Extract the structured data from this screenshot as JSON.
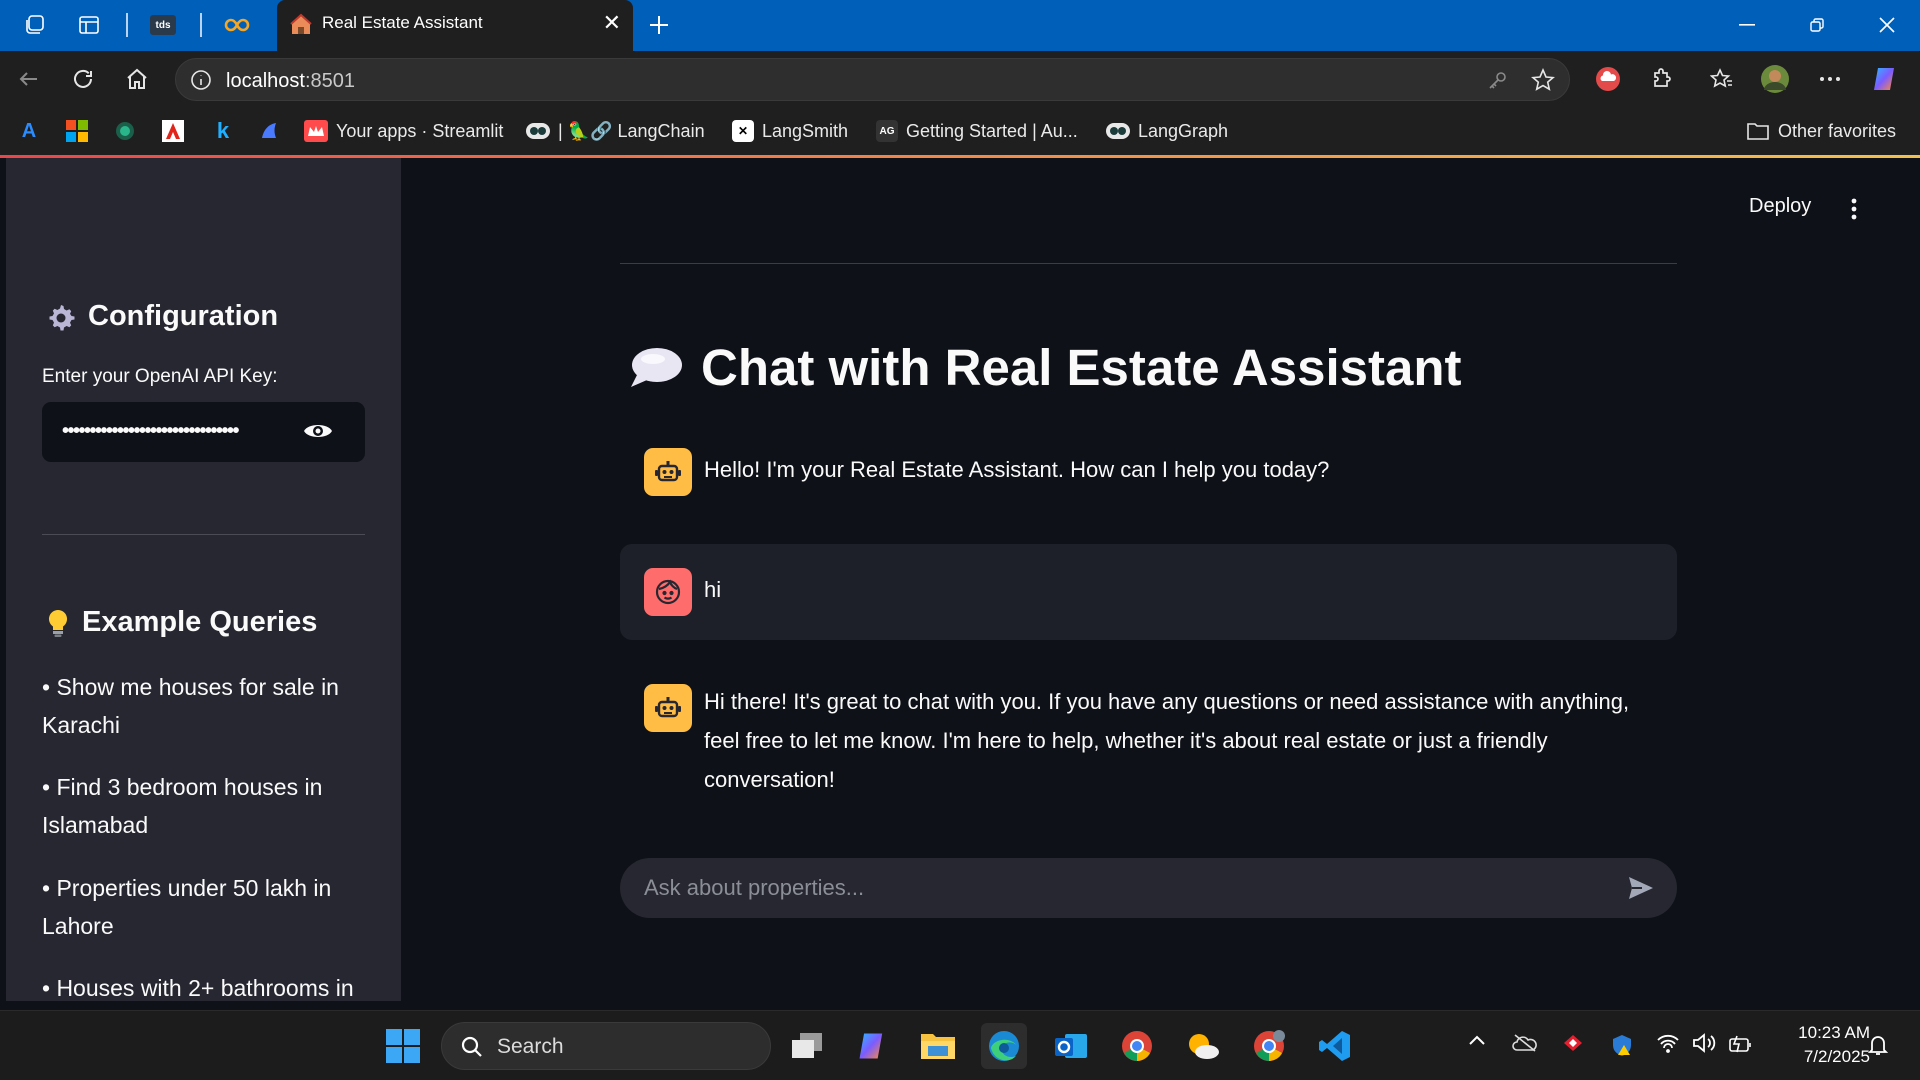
{
  "browser": {
    "tabs": [
      {
        "label": "tds"
      },
      {
        "label": "Real Estate Assistant",
        "active": true
      }
    ],
    "address": {
      "host": "localhost",
      "port": ":8501"
    },
    "bookmarks": [
      {
        "label": "Your apps · Streamlit"
      },
      {
        "label": "| 🦜🔗 LangChain"
      },
      {
        "label": "LangSmith"
      },
      {
        "label": "Getting Started | Au..."
      },
      {
        "label": "LangGraph"
      }
    ],
    "other_favorites": "Other favorites"
  },
  "sidebar": {
    "config_title": "Configuration",
    "api_key_label": "Enter your OpenAI API Key:",
    "api_key_masked": "••••••••••••••••••••••••••••••••",
    "examples_title": "Example Queries",
    "examples": [
      "• Show me houses for sale in Karachi",
      "• Find 3 bedroom houses in Islamabad",
      "• Properties under 50 lakh in Lahore",
      "• Houses with 2+ bathrooms in"
    ]
  },
  "header": {
    "deploy_label": "Deploy"
  },
  "main": {
    "title": "Chat with Real Estate Assistant",
    "messages": [
      {
        "role": "assistant",
        "text": "Hello! I'm your Real Estate Assistant. How can I help you today?"
      },
      {
        "role": "user",
        "text": "hi"
      },
      {
        "role": "assistant",
        "text": "Hi there! It's great to chat with you. If you have any questions or need assistance with anything, feel free to let me know. I'm here to help, whether it's about real estate or just a friendly conversation!"
      }
    ],
    "chat_placeholder": "Ask about properties..."
  },
  "taskbar": {
    "search_label": "Search",
    "time": "10:23 AM",
    "date": "7/2/2025"
  },
  "colors": {
    "titlebar": "#005fb8",
    "app_bg": "#0e1117",
    "sidebar_bg": "#262730",
    "bot_avatar": "#ffbd45",
    "user_avatar": "#ff6c6c"
  }
}
